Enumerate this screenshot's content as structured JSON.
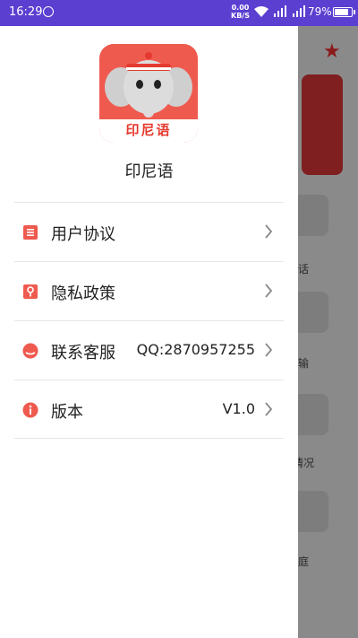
{
  "status_bar": {
    "time": "16:29",
    "net_speed": "0.00",
    "net_unit": "KB/S",
    "battery": "79%"
  },
  "drawer": {
    "logo_text": "印尼语",
    "app_name": "印尼语",
    "items": [
      {
        "label": "用户协议",
        "value": "",
        "icon": "document-icon"
      },
      {
        "label": "隐私政策",
        "value": "",
        "icon": "privacy-icon"
      },
      {
        "label": "联系客服",
        "value": "QQ:2870957255",
        "icon": "customer-service-icon"
      },
      {
        "label": "版本",
        "value": "V1.0",
        "icon": "info-icon"
      }
    ],
    "accent_color": "#ef5a4f"
  },
  "background": {
    "labels": [
      "话",
      "输",
      "情况",
      "庭"
    ]
  }
}
